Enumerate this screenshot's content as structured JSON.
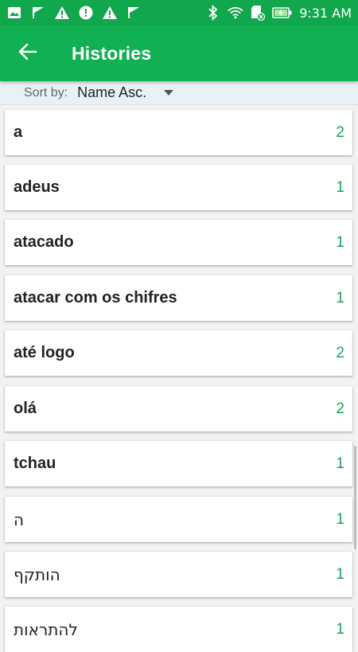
{
  "status_bar": {
    "time": "9:31 AM"
  },
  "app_bar": {
    "title": "Histories",
    "back_icon": "arrow-left-icon"
  },
  "sort": {
    "label": "Sort by:",
    "value": "Name Asc."
  },
  "colors": {
    "primary": "#11b052",
    "status_bar": "#11a74c",
    "count": "#1aa35a"
  },
  "items": [
    {
      "word": "a",
      "count": "2"
    },
    {
      "word": "adeus",
      "count": "1"
    },
    {
      "word": "atacado",
      "count": "1"
    },
    {
      "word": "atacar com os chifres",
      "count": "1"
    },
    {
      "word": "até logo",
      "count": "2"
    },
    {
      "word": "olá",
      "count": "2"
    },
    {
      "word": "tchau",
      "count": "1"
    },
    {
      "word": "ה",
      "count": "1"
    },
    {
      "word": "הותקף",
      "count": "1"
    },
    {
      "word": "להתראות",
      "count": "1"
    }
  ]
}
